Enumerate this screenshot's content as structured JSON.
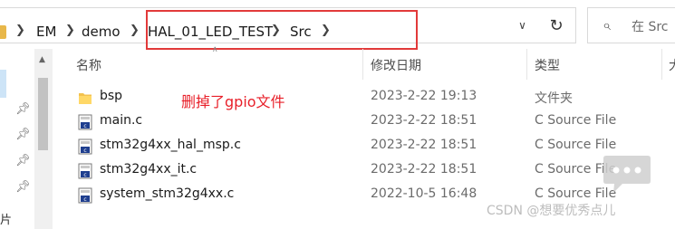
{
  "address_bar": {
    "breadcrumb": [
      "EM",
      "demo",
      "HAL_01_LED_TEST",
      "Src"
    ],
    "search_placeholder": "在 Src"
  },
  "nav": {
    "fragment": "片"
  },
  "columns": {
    "name": "名称",
    "date": "修改日期",
    "type": "类型",
    "size": "大"
  },
  "files": [
    {
      "name": "bsp",
      "date": "2023-2-22 19:13",
      "type": "文件夹",
      "icon": "folder-icon"
    },
    {
      "name": "main.c",
      "date": "2023-2-22 18:51",
      "type": "C Source File",
      "icon": "c-file-icon"
    },
    {
      "name": "stm32g4xx_hal_msp.c",
      "date": "2023-2-22 18:51",
      "type": "C Source File",
      "icon": "c-file-icon"
    },
    {
      "name": "stm32g4xx_it.c",
      "date": "2023-2-22 18:51",
      "type": "C Source File",
      "icon": "c-file-icon"
    },
    {
      "name": "system_stm32g4xx.c",
      "date": "2022-10-5 16:48",
      "type": "C Source File",
      "icon": "c-file-icon"
    }
  ],
  "annotation": "删掉了gpio文件",
  "watermark": "CSDN @想要优秀点儿",
  "colors": {
    "annotation": "#e8202a",
    "highlight_box": "#e23a3a"
  }
}
